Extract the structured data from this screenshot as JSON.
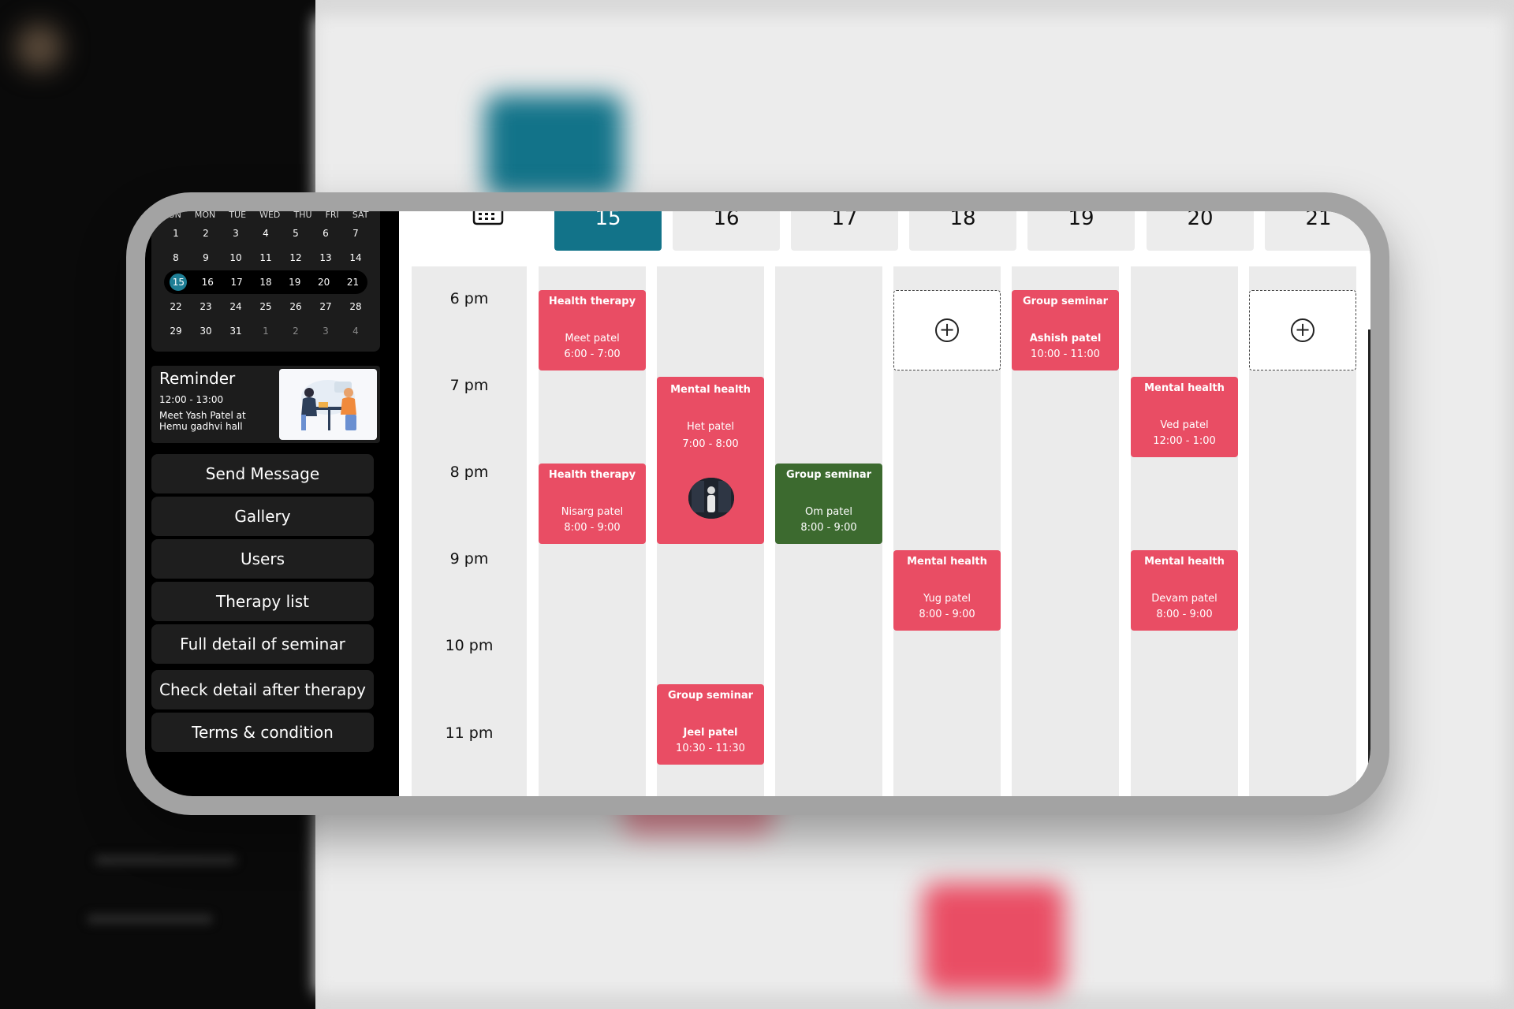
{
  "calendar": {
    "weekdays": [
      "SUN",
      "MON",
      "TUE",
      "WED",
      "THU",
      "FRI",
      "SAT"
    ],
    "weeks": [
      [
        "1",
        "2",
        "3",
        "4",
        "5",
        "6",
        "7"
      ],
      [
        "8",
        "9",
        "10",
        "11",
        "12",
        "13",
        "14"
      ],
      [
        "15",
        "16",
        "17",
        "18",
        "19",
        "20",
        "21"
      ],
      [
        "22",
        "23",
        "24",
        "25",
        "26",
        "27",
        "28"
      ],
      [
        "29",
        "30",
        "31",
        "1",
        "2",
        "3",
        "4"
      ]
    ],
    "selected_day": "15"
  },
  "reminder": {
    "title": "Reminder",
    "time": "12:00 - 13:00",
    "description": "Meet Yash Patel at Hemu gadhvi hall"
  },
  "menu": [
    "Send Message",
    "Gallery",
    "Users",
    "Therapy list",
    "Full detail of seminar",
    "Check detail after therapy",
    "Terms & condition"
  ],
  "schedule": {
    "days": [
      "15",
      "16",
      "17",
      "18",
      "19",
      "20",
      "21"
    ],
    "selected_day": "15",
    "time_labels": [
      "6 pm",
      "7 pm",
      "8 pm",
      "9 pm",
      "10 pm",
      "11 pm"
    ],
    "events": [
      {
        "title": "Health therapy",
        "name": "Meet patel",
        "time": "6:00 - 7:00",
        "color": "#e94d64"
      },
      {
        "title": "Health therapy",
        "name": "Nisarg patel",
        "time": "8:00 - 9:00",
        "color": "#e94d64"
      },
      {
        "title": "Mental health",
        "name": "Het patel",
        "time": "7:00 - 8:00",
        "color": "#e94d64"
      },
      {
        "title": "Group seminar",
        "name": "Jeel patel",
        "time": "10:30 - 11:30",
        "color": "#e94d64"
      },
      {
        "title": "Group seminar",
        "name": "Om patel",
        "time": "8:00 - 9:00",
        "color": "#3c6a2f"
      },
      {
        "title": "Mental health",
        "name": "Yug patel",
        "time": "8:00 - 9:00",
        "color": "#e94d64"
      },
      {
        "title": "Group seminar",
        "name": "Ashish patel",
        "time": "10:00 - 11:00",
        "color": "#e94d64"
      },
      {
        "title": "Mental health",
        "name": "Ved patel",
        "time": "12:00 - 1:00",
        "color": "#e94d64"
      },
      {
        "title": "Mental health",
        "name": "Devam patel",
        "time": "8:00 - 9:00",
        "color": "#e94d64"
      }
    ]
  },
  "colors": {
    "accent": "#127389",
    "event_red": "#e94d64",
    "event_green": "#3c6a2f"
  }
}
